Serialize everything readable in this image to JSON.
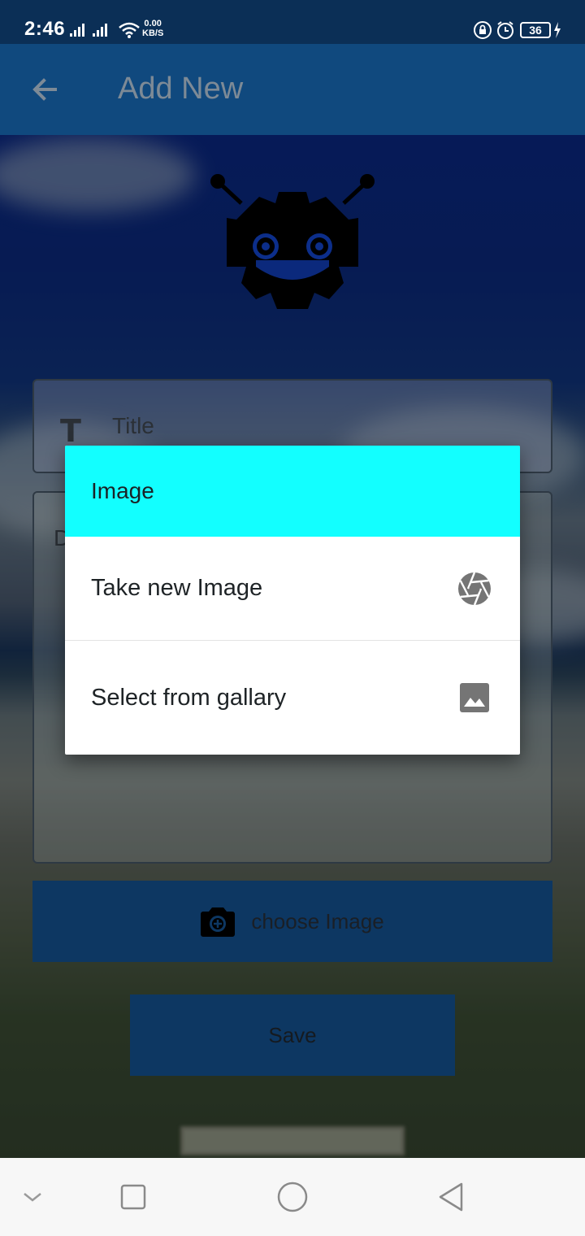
{
  "status_bar": {
    "time": "2:46",
    "net_speed_value": "0.00",
    "net_speed_unit": "KB/S",
    "battery_level": "36"
  },
  "app_bar": {
    "title": "Add New",
    "back_icon": "arrow-back-icon"
  },
  "form": {
    "title_placeholder": "Title",
    "title_icon": "T",
    "description_placeholder": "D",
    "choose_image_label": "choose Image",
    "choose_image_icon": "camera-icon",
    "save_label": "Save"
  },
  "dialog": {
    "title": "Image",
    "header_color": "#12ffff",
    "options": [
      {
        "label": "Take new Image",
        "icon": "camera-shutter-icon"
      },
      {
        "label": "Select from gallary",
        "icon": "image-icon"
      }
    ]
  },
  "colors": {
    "app_bar": "#10497e",
    "status_bar": "#0b2f56",
    "button": "#0d3762"
  }
}
